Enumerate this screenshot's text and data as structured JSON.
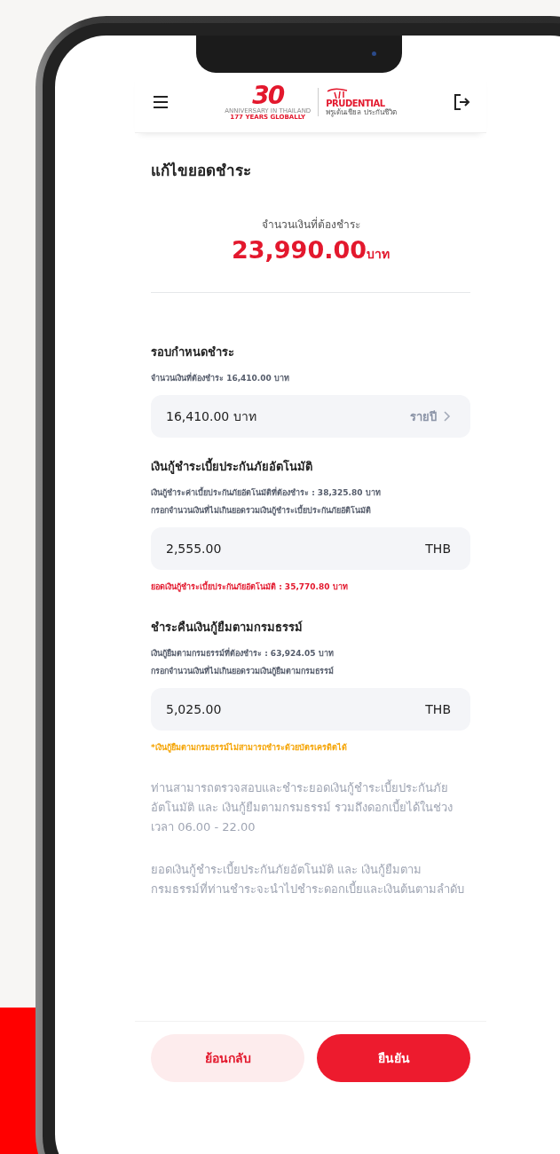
{
  "header": {
    "logo_number": "30",
    "logo_anniversary": "ANNIVERSARY IN THAILAND",
    "logo_years": "177 YEARS GLOBALLY",
    "brand_name": "PRUDENTIAL",
    "brand_thai": "พรูเด้นเชียล ประกันชีวิต"
  },
  "title": "แก้ไขยอดชำระ",
  "total": {
    "label": "จำนวนเงินที่ต้องชำระ",
    "amount": "23,990.00",
    "unit": "บาท"
  },
  "sections": [
    {
      "title": "รอบกำหนดชำระ",
      "notes": [
        "จำนวนเงินที่ต้องชำระ 16,410.00 บาท"
      ],
      "field": {
        "kind": "select",
        "value": "16,410.00  บาท",
        "suffix": "รายปี"
      }
    },
    {
      "title": "เงินกู้ชำระเบี้ยประกันภัยอัตโนมัติ",
      "notes": [
        "เงินกู้ชำระค่าเบี้ยประกันภัยอัตโนมัติที่ต้องชำระ : 38,325.80 บาท",
        "กรอกจำนวนเงินที่ไม่เกินยอดรวมเงินกู้ชำระเบี้ยประกันภัยอัติโนมัติ"
      ],
      "field": {
        "kind": "input",
        "value": "2,555.00",
        "suffix": "THB"
      },
      "alert": {
        "kind": "error",
        "text": "ยอดเงินกู้ชำระเบี้ยประกันภัยอัตโนมัติ : 35,770.80 บาท"
      }
    },
    {
      "title": "ชำระคืนเงินกู้ยืมตามกรมธรรม์",
      "notes": [
        "เงินกู้ยืมตามกรมธรรม์ที่ต้องชำระ : 63,924.05 บาท",
        "กรอกจำนวนเงินที่ไม่เกินยอดรวมเงินกู้ยืมตามกรมธรรม์"
      ],
      "field": {
        "kind": "input",
        "value": "5,025.00",
        "suffix": "THB"
      },
      "alert": {
        "kind": "warning",
        "text": "*เงินกู้ยืมตามกรมธรรม์ไม่สามารถชำระด้วยบัตรเครดิตได้"
      }
    }
  ],
  "info": [
    "ท่านสามารถตรวจสอบและชำระยอดเงินกู้ชำระเบี้ยประกันภัย อัตโนมัติ และ เงินกู้ยืมตามกรมธรรม์ รวมถึงดอกเบี้ยได้ในช่วง เวลา 06.00 - 22.00",
    "ยอดเงินกู้ชำระเบี้ยประกันภัยอัตโนมัติ และ เงินกู้ยืมตาม กรมธรรม์ที่ท่านชำระจะนำไปชำระดอกเบี้ยและเงินต้นตามลำดับ"
  ],
  "buttons": [
    {
      "kind": "secondary",
      "label": "ย้อนกลับ"
    },
    {
      "kind": "primary",
      "label": "ยืนยัน"
    }
  ]
}
